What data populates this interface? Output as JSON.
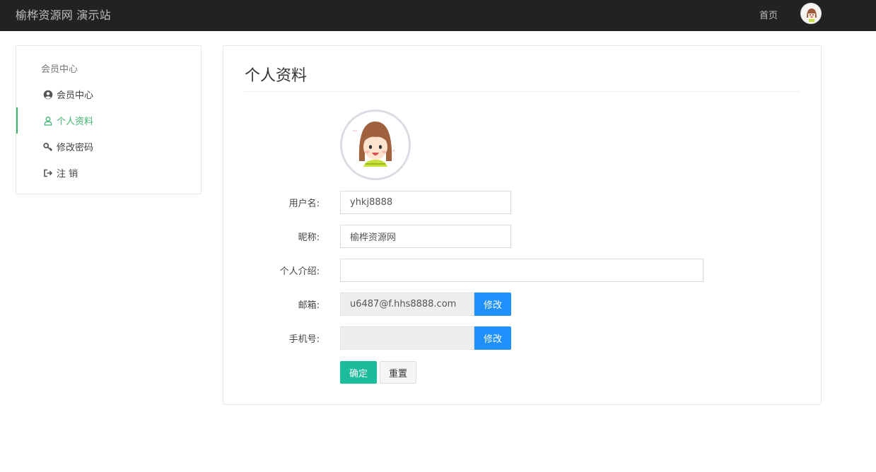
{
  "header": {
    "brand": "榆桦资源网 演示站",
    "home_link": "首页"
  },
  "sidebar": {
    "title": "会员中心",
    "items": [
      {
        "label": "会员中心",
        "icon": "user-circle-icon"
      },
      {
        "label": "个人资料",
        "icon": "user-outline-icon",
        "active": true
      },
      {
        "label": "修改密码",
        "icon": "key-icon"
      },
      {
        "label": "注 销",
        "icon": "logout-icon"
      }
    ]
  },
  "main": {
    "title": "个人资料",
    "form": {
      "username_label": "用户名:",
      "username_value": "yhkj8888",
      "nickname_label": "昵称:",
      "nickname_value": "榆桦资源网",
      "bio_label": "个人介绍:",
      "bio_value": "",
      "email_label": "邮箱:",
      "email_value": "u6487@f.hhs8888.com",
      "email_edit_label": "修改",
      "phone_label": "手机号:",
      "phone_value": "",
      "phone_edit_label": "修改",
      "submit_label": "确定",
      "reset_label": "重置"
    }
  },
  "colors": {
    "topbar_bg": "#222222",
    "active_green": "#3fb56e",
    "edit_blue": "#1e90ff",
    "submit_teal": "#1abc9c"
  }
}
